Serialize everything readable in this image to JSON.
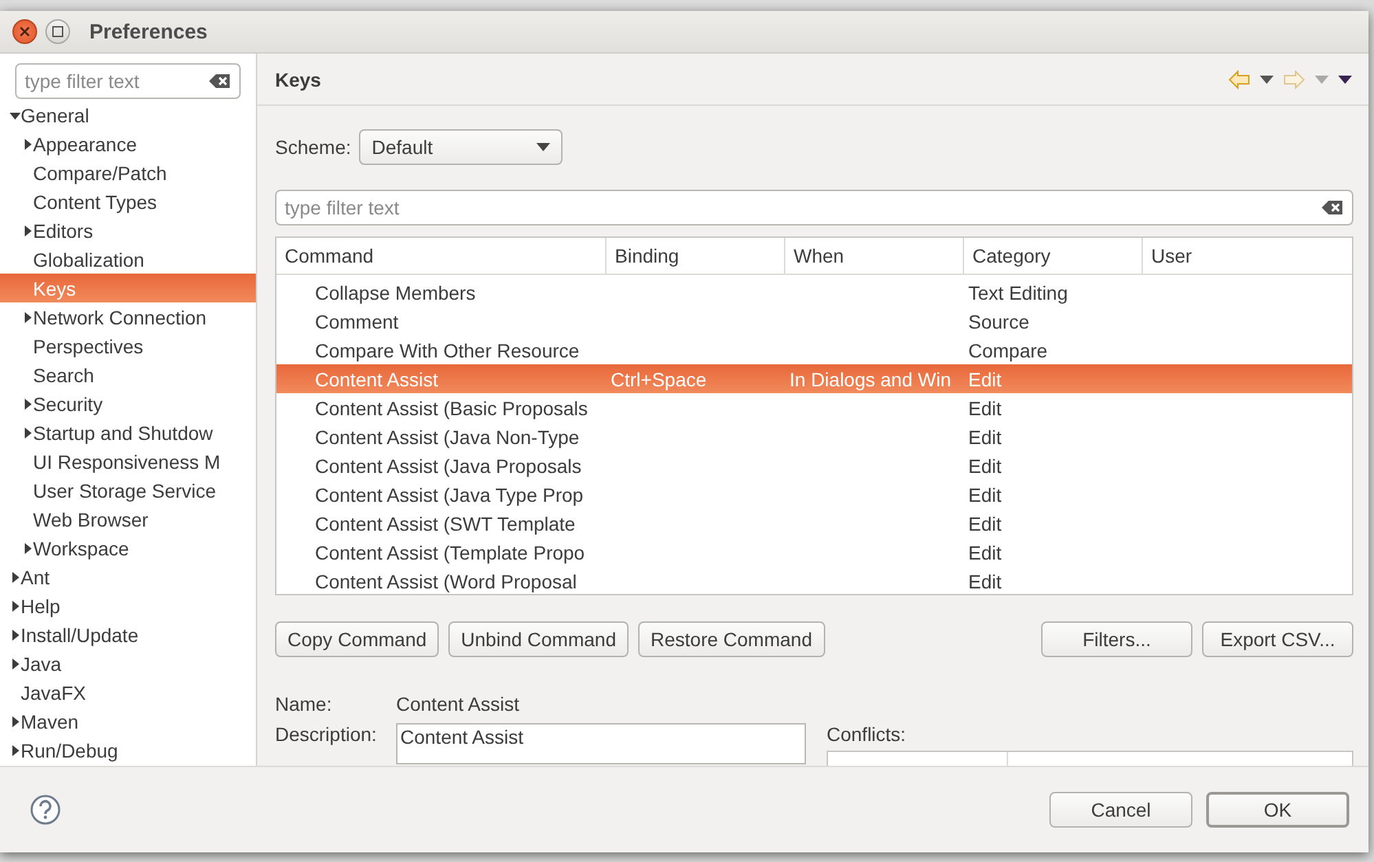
{
  "window": {
    "title": "Preferences"
  },
  "sidebar": {
    "filter": {
      "placeholder": "type filter text"
    },
    "items": [
      {
        "label": "General",
        "kind": "branch",
        "expanded": true,
        "selected": false,
        "children": [
          {
            "label": "Appearance",
            "kind": "branch",
            "expanded": false,
            "selected": false
          },
          {
            "label": "Compare/Patch",
            "kind": "leaf",
            "selected": false
          },
          {
            "label": "Content Types",
            "kind": "leaf",
            "selected": false
          },
          {
            "label": "Editors",
            "kind": "branch",
            "expanded": false,
            "selected": false
          },
          {
            "label": "Globalization",
            "kind": "leaf",
            "selected": false
          },
          {
            "label": "Keys",
            "kind": "leaf",
            "selected": true
          },
          {
            "label": "Network Connection",
            "kind": "branch",
            "expanded": false,
            "selected": false
          },
          {
            "label": "Perspectives",
            "kind": "leaf",
            "selected": false
          },
          {
            "label": "Search",
            "kind": "leaf",
            "selected": false
          },
          {
            "label": "Security",
            "kind": "branch",
            "expanded": false,
            "selected": false
          },
          {
            "label": "Startup and Shutdow",
            "kind": "branch",
            "expanded": false,
            "selected": false
          },
          {
            "label": "UI Responsiveness M",
            "kind": "leaf",
            "selected": false
          },
          {
            "label": "User Storage Service",
            "kind": "leaf",
            "selected": false
          },
          {
            "label": "Web Browser",
            "kind": "leaf",
            "selected": false
          },
          {
            "label": "Workspace",
            "kind": "branch",
            "expanded": false,
            "selected": false
          }
        ]
      },
      {
        "label": "Ant",
        "kind": "branch",
        "expanded": false,
        "selected": false
      },
      {
        "label": "Help",
        "kind": "branch",
        "expanded": false,
        "selected": false
      },
      {
        "label": "Install/Update",
        "kind": "branch",
        "expanded": false,
        "selected": false
      },
      {
        "label": "Java",
        "kind": "branch",
        "expanded": false,
        "selected": false
      },
      {
        "label": "JavaFX",
        "kind": "leaf",
        "selected": false
      },
      {
        "label": "Maven",
        "kind": "branch",
        "expanded": false,
        "selected": false
      },
      {
        "label": "Run/Debug",
        "kind": "branch",
        "expanded": false,
        "selected": false
      }
    ]
  },
  "page": {
    "title": "Keys",
    "nav": [
      {
        "kind": "back",
        "disabled": false
      },
      {
        "kind": "forward",
        "disabled": true
      }
    ],
    "scheme": {
      "label": "Scheme:",
      "value": "Default"
    },
    "filter": {
      "placeholder": "type filter text"
    },
    "table": {
      "columns": [
        "Command",
        "Binding",
        "When",
        "Category",
        "User"
      ],
      "rows": [
        {
          "cells": [
            "Collapse Members",
            "",
            "",
            "Text Editing",
            ""
          ],
          "selected": false
        },
        {
          "cells": [
            "Comment",
            "",
            "",
            "Source",
            ""
          ],
          "selected": false
        },
        {
          "cells": [
            "Compare With Other Resource",
            "",
            "",
            "Compare",
            ""
          ],
          "selected": false
        },
        {
          "cells": [
            "Content Assist",
            "Ctrl+Space",
            "In Dialogs and Win",
            "Edit",
            ""
          ],
          "selected": true
        },
        {
          "cells": [
            "Content Assist (Basic Proposals",
            "",
            "",
            "Edit",
            ""
          ],
          "selected": false
        },
        {
          "cells": [
            "Content Assist (Java Non-Type",
            "",
            "",
            "Edit",
            ""
          ],
          "selected": false
        },
        {
          "cells": [
            "Content Assist (Java Proposals",
            "",
            "",
            "Edit",
            ""
          ],
          "selected": false
        },
        {
          "cells": [
            "Content Assist (Java Type Prop",
            "",
            "",
            "Edit",
            ""
          ],
          "selected": false
        },
        {
          "cells": [
            "Content Assist (SWT Template",
            "",
            "",
            "Edit",
            ""
          ],
          "selected": false
        },
        {
          "cells": [
            "Content Assist (Template Propo",
            "",
            "",
            "Edit",
            ""
          ],
          "selected": false
        },
        {
          "cells": [
            "Content Assist (Word Proposal",
            "",
            "",
            "Edit",
            ""
          ],
          "selected": false
        }
      ]
    },
    "left_buttons": [
      "Copy Command",
      "Unbind Command",
      "Restore Command"
    ],
    "right_buttons": [
      "Filters...",
      "Export CSV..."
    ],
    "details": {
      "name_label": "Name:",
      "name_value": "Content Assist",
      "description_label": "Description:",
      "description_value": "Content Assist",
      "conflicts_label": "Conflicts:"
    }
  },
  "footer": {
    "buttons": [
      {
        "label": "Cancel",
        "default": false
      },
      {
        "label": "OK",
        "default": true
      }
    ]
  }
}
